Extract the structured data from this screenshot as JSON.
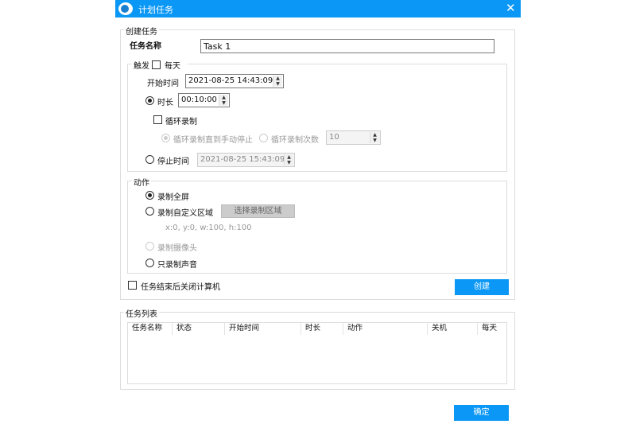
{
  "window": {
    "title": "计划任务",
    "close_icon": "close-icon",
    "app_icon": "camera-icon",
    "accent": "#0a97f5"
  },
  "create": {
    "group_label": "创建任务",
    "name_label": "任务名称",
    "name_value": "Task 1",
    "trigger": {
      "label": "触发",
      "daily_label": "每天",
      "daily_checked": false,
      "start_label": "开始时间",
      "start_value": "2021-08-25 14:43:09",
      "duration_label": "时长",
      "duration_value": "00:10:00",
      "duration_selected": true,
      "loop_label": "循环录制",
      "loop_checked": false,
      "loop_until_stop_label": "循环录制直到手动停止",
      "loop_count_label": "循环录制次数",
      "loop_count_value": "10",
      "stop_label": "停止时间",
      "stop_value": "2021-08-25 15:43:09"
    },
    "action": {
      "label": "动作",
      "fullscreen_label": "录制全屏",
      "custom_label": "录制自定义区域",
      "select_region_button": "选择录制区域",
      "region_text": "x:0, y:0, w:100, h:100",
      "camera_label": "录制摄像头",
      "audio_only_label": "只录制声音",
      "selected": "fullscreen"
    },
    "shutdown_label": "任务结束后关闭计算机",
    "shutdown_checked": false,
    "create_button": "创建"
  },
  "task_list": {
    "group_label": "任务列表",
    "columns": [
      "任务名称",
      "状态",
      "开始时间",
      "时长",
      "动作",
      "关机",
      "每天"
    ],
    "rows": []
  },
  "ok_button": "确定"
}
